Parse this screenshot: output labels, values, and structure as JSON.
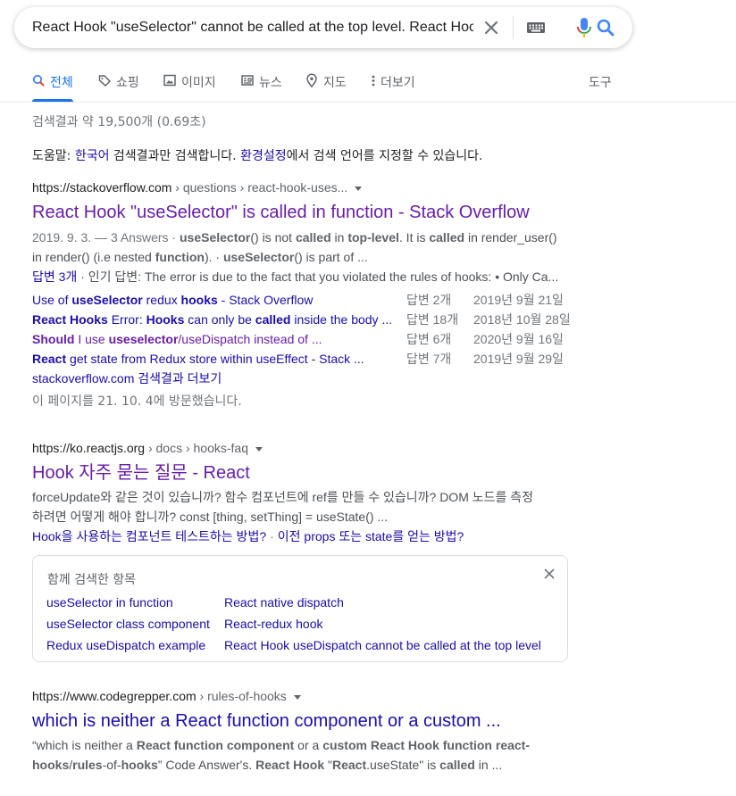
{
  "search": {
    "query": "React Hook \"useSelector\" cannot be called at the top level. React Hoc"
  },
  "tabs": [
    {
      "label": "전체",
      "icon": "search-icon",
      "active": true
    },
    {
      "label": "쇼핑",
      "icon": "tag-icon"
    },
    {
      "label": "이미지",
      "icon": "image-icon"
    },
    {
      "label": "뉴스",
      "icon": "news-icon"
    },
    {
      "label": "지도",
      "icon": "map-pin-icon"
    },
    {
      "label": "더보기",
      "icon": "more-vert-icon"
    }
  ],
  "tools_label": "도구",
  "stats": "검색결과 약 19,500개 (0.69초)",
  "lang_note": {
    "prefix": "도움말: ",
    "lang": "한국어",
    "mid": " 검색결과만 검색합니다. ",
    "settings": "환경설정",
    "suffix": "에서 검색 언어를 지정할 수 있습니다."
  },
  "results": [
    {
      "domain": "https://stackoverflow.com",
      "crumb": " › questions › react-hook-uses...",
      "title": "React Hook \"useSelector\" is called in function - Stack Overflow",
      "date": "2019. 9. 3. — 3 Answers · ",
      "snippet_l1": {
        "b1": "useSelector",
        "t1": "() is not ",
        "b2": "called",
        "t2": " in ",
        "b3": "top-level",
        "t3": ". It is ",
        "b4": "called",
        "t4": " in render_user()"
      },
      "snippet_l2": {
        "t1": "in render() (i.e nested ",
        "b1": "function",
        "t2": "). · ",
        "b2": "useSelector",
        "t3": "() is part of ..."
      },
      "top_answer": {
        "link": "답변 3개",
        "sep": " · 인기 답변: ",
        "text": "The error is due to the fact that you violated the rules of hooks: • Only Ca..."
      },
      "sub_results": [
        {
          "parts": [
            {
              "t": "Use of "
            },
            {
              "b": "useSelector"
            },
            {
              "t": " redux "
            },
            {
              "b": "hooks"
            },
            {
              "t": " - Stack Overflow"
            }
          ],
          "answers": "답변 2개",
          "date": "2019년 9월 21일",
          "visited": false
        },
        {
          "parts": [
            {
              "b": "React Hooks"
            },
            {
              "t": " Error: "
            },
            {
              "b": "Hooks"
            },
            {
              "t": " can only be "
            },
            {
              "b": "called"
            },
            {
              "t": " inside the body ..."
            }
          ],
          "answers": "답변 18개",
          "date": "2018년 10월 28일",
          "visited": false
        },
        {
          "parts": [
            {
              "b": "Should"
            },
            {
              "t": " I use "
            },
            {
              "b": "useselector"
            },
            {
              "t": "/useDispatch instead of ..."
            }
          ],
          "answers": "답변 6개",
          "date": "2020년 9월 16일",
          "visited": true
        },
        {
          "parts": [
            {
              "b": "React"
            },
            {
              "t": " get state from Redux store within useEffect - Stack ..."
            }
          ],
          "answers": "답변 7개",
          "date": "2019년 9월 29일",
          "visited": false
        }
      ],
      "more": "stackoverflow.com 검색결과 더보기",
      "visited_note": "이 페이지를 21. 10. 4에 방문했습니다."
    },
    {
      "domain": "https://ko.reactjs.org",
      "crumb": " › docs › hooks-faq",
      "title": "Hook 자주 묻는 질문 - React",
      "snippet_l1": "forceUpdate와 같은 것이 있습니까? 함수 컴포넌트에 ref를 만들 수 있습니까? DOM 노드를 측정",
      "snippet_l2": "하려면 어떻게 해야 합니까? const [thing, setThing] = useState() ...",
      "sitelinks": [
        "Hook을 사용하는 컴포넌트 테스트하는 방법?",
        "이전 props 또는 state를 얻는 방법?"
      ]
    },
    {
      "domain": "https://www.codegrepper.com",
      "crumb": " › rules-of-hooks",
      "title": "which is neither a React function component or a custom ...",
      "snippet_l1": {
        "t1": "“which is neither a ",
        "b1": "React function component",
        "t2": " or a ",
        "b2": "custom React Hook function react-"
      },
      "snippet_l2": {
        "b1": "hooks",
        "t1": "/",
        "b2": "rules",
        "t2": "-of-",
        "b3": "hooks",
        "t3": "” Code Answer's. ",
        "b4": "React Hook",
        "t4": " \"",
        "b5": "React",
        "t5": ".useState\" is ",
        "b6": "called",
        "t6": " in ..."
      }
    }
  ],
  "related": {
    "title": "함께 검색한 항목",
    "left": [
      "useSelector in function",
      "useSelector class component",
      "Redux useDispatch example"
    ],
    "right": [
      "React native dispatch",
      "React-redux hook",
      "React Hook useDispatch cannot be called at the top level"
    ]
  },
  "colors": {
    "link": "#1a0dab",
    "visited": "#681da8",
    "accent": "#1a73e8"
  }
}
